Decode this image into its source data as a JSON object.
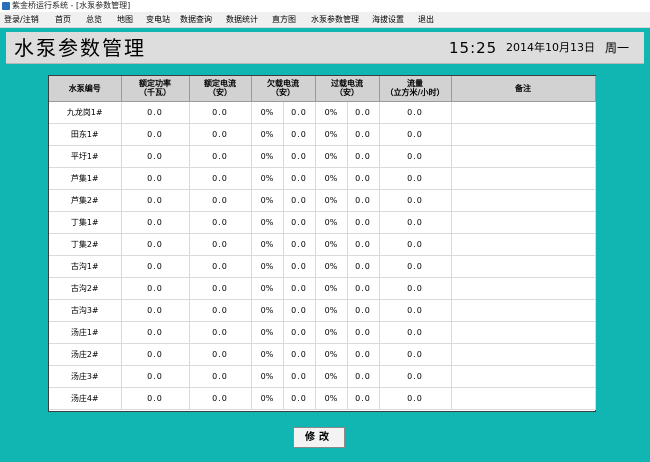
{
  "window": {
    "title": "紫金桥运行系统 - [水泵参数管理]"
  },
  "menu": [
    "登录/注销",
    "首页",
    "总览",
    "地图",
    "变电站",
    "数据查询",
    "数据统计",
    "直方图",
    "水泵参数管理",
    "海拔设置",
    "退出"
  ],
  "header": {
    "title": "水泵参数管理",
    "time": "15:25",
    "date": "2014年10月13日",
    "weekday": "周一"
  },
  "table": {
    "columns": [
      {
        "line1": "水泵编号",
        "line2": ""
      },
      {
        "line1": "额定功率",
        "line2": "（千瓦）"
      },
      {
        "line1": "额定电流",
        "line2": "（安）"
      },
      {
        "line1": "欠载电流",
        "line2": "（安）"
      },
      {
        "line1": "过载电流",
        "line2": "（安）"
      },
      {
        "line1": "流量",
        "line2": "（立方米/小时）"
      },
      {
        "line1": "备注",
        "line2": ""
      }
    ],
    "rows": [
      {
        "name": "九龙岗1#",
        "power": "0.0",
        "current": "0.0",
        "under_pct": "0%",
        "under_val": "0.0",
        "over_pct": "0%",
        "over_val": "0.0",
        "flow": "0.0",
        "note": ""
      },
      {
        "name": "田东1#",
        "power": "0.0",
        "current": "0.0",
        "under_pct": "0%",
        "under_val": "0.0",
        "over_pct": "0%",
        "over_val": "0.0",
        "flow": "0.0",
        "note": ""
      },
      {
        "name": "平圩1#",
        "power": "0.0",
        "current": "0.0",
        "under_pct": "0%",
        "under_val": "0.0",
        "over_pct": "0%",
        "over_val": "0.0",
        "flow": "0.0",
        "note": ""
      },
      {
        "name": "芦集1#",
        "power": "0.0",
        "current": "0.0",
        "under_pct": "0%",
        "under_val": "0.0",
        "over_pct": "0%",
        "over_val": "0.0",
        "flow": "0.0",
        "note": ""
      },
      {
        "name": "芦集2#",
        "power": "0.0",
        "current": "0.0",
        "under_pct": "0%",
        "under_val": "0.0",
        "over_pct": "0%",
        "over_val": "0.0",
        "flow": "0.0",
        "note": ""
      },
      {
        "name": "丁集1#",
        "power": "0.0",
        "current": "0.0",
        "under_pct": "0%",
        "under_val": "0.0",
        "over_pct": "0%",
        "over_val": "0.0",
        "flow": "0.0",
        "note": ""
      },
      {
        "name": "丁集2#",
        "power": "0.0",
        "current": "0.0",
        "under_pct": "0%",
        "under_val": "0.0",
        "over_pct": "0%",
        "over_val": "0.0",
        "flow": "0.0",
        "note": ""
      },
      {
        "name": "古沟1#",
        "power": "0.0",
        "current": "0.0",
        "under_pct": "0%",
        "under_val": "0.0",
        "over_pct": "0%",
        "over_val": "0.0",
        "flow": "0.0",
        "note": ""
      },
      {
        "name": "古沟2#",
        "power": "0.0",
        "current": "0.0",
        "under_pct": "0%",
        "under_val": "0.0",
        "over_pct": "0%",
        "over_val": "0.0",
        "flow": "0.0",
        "note": ""
      },
      {
        "name": "古沟3#",
        "power": "0.0",
        "current": "0.0",
        "under_pct": "0%",
        "under_val": "0.0",
        "over_pct": "0%",
        "over_val": "0.0",
        "flow": "0.0",
        "note": ""
      },
      {
        "name": "汤庄1#",
        "power": "0.0",
        "current": "0.0",
        "under_pct": "0%",
        "under_val": "0.0",
        "over_pct": "0%",
        "over_val": "0.0",
        "flow": "0.0",
        "note": ""
      },
      {
        "name": "汤庄2#",
        "power": "0.0",
        "current": "0.0",
        "under_pct": "0%",
        "under_val": "0.0",
        "over_pct": "0%",
        "over_val": "0.0",
        "flow": "0.0",
        "note": ""
      },
      {
        "name": "汤庄3#",
        "power": "0.0",
        "current": "0.0",
        "under_pct": "0%",
        "under_val": "0.0",
        "over_pct": "0%",
        "over_val": "0.0",
        "flow": "0.0",
        "note": ""
      },
      {
        "name": "汤庄4#",
        "power": "0.0",
        "current": "0.0",
        "under_pct": "0%",
        "under_val": "0.0",
        "over_pct": "0%",
        "over_val": "0.0",
        "flow": "0.0",
        "note": ""
      }
    ]
  },
  "buttons": {
    "edit": "修改"
  },
  "colors": {
    "background": "#11b6b3",
    "header": "#dddddd",
    "table_header": "#d2d2d2"
  }
}
